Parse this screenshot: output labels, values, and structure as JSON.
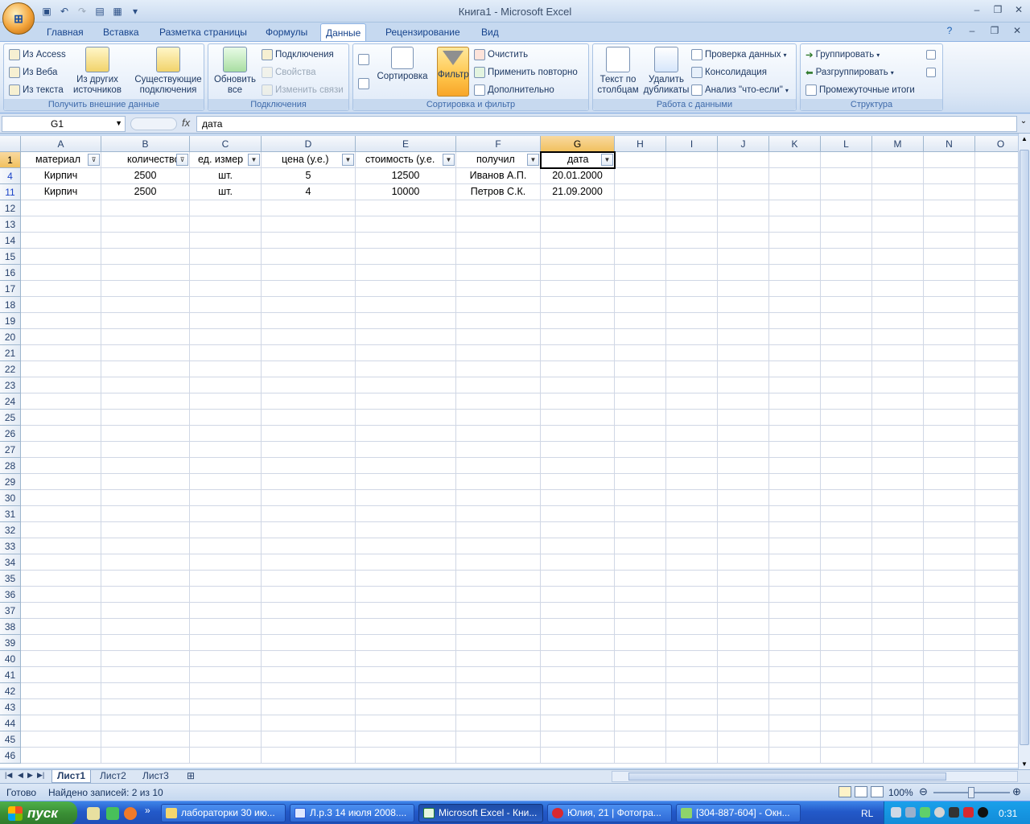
{
  "window": {
    "title": "Книга1 - Microsoft Excel",
    "office_button": "⊞"
  },
  "tabs": [
    "Главная",
    "Вставка",
    "Разметка страницы",
    "Формулы",
    "Данные",
    "Рецензирование",
    "Вид"
  ],
  "active_tab": "Данные",
  "ribbon": {
    "external": {
      "access": "Из Access",
      "web": "Из Веба",
      "text": "Из текста",
      "other_1": "Из других",
      "other_2": "источников",
      "existing_1": "Существующие",
      "existing_2": "подключения",
      "label": "Получить внешние данные"
    },
    "connections": {
      "refresh_1": "Обновить",
      "refresh_2": "все",
      "connections": "Подключения",
      "properties": "Свойства",
      "edit_links": "Изменить связи",
      "label": "Подключения"
    },
    "sort": {
      "sort": "Сортировка",
      "filter": "Фильтр",
      "clear": "Очистить",
      "reapply": "Применить повторно",
      "advanced": "Дополнительно",
      "label": "Сортировка и фильтр"
    },
    "data_tools": {
      "text_cols_1": "Текст по",
      "text_cols_2": "столбцам",
      "remove_dup_1": "Удалить",
      "remove_dup_2": "дубликаты",
      "validation": "Проверка данных",
      "consolidate": "Консолидация",
      "whatif": "Анализ \"что-если\"",
      "label": "Работа с данными"
    },
    "outline": {
      "group": "Группировать",
      "ungroup": "Разгруппировать",
      "subtotal": "Промежуточные итоги",
      "label": "Структура"
    }
  },
  "formula_bar": {
    "name_box": "G1",
    "fx": "fx",
    "value": "дата"
  },
  "columns": [
    "A",
    "B",
    "C",
    "D",
    "E",
    "F",
    "G",
    "H",
    "I",
    "J",
    "K",
    "L",
    "M",
    "N",
    "O"
  ],
  "rows": [
    "1",
    "4",
    "11",
    "12",
    "13",
    "14",
    "15",
    "16",
    "17",
    "18",
    "19",
    "20",
    "21",
    "22",
    "23",
    "24",
    "25",
    "26",
    "27",
    "28",
    "29",
    "30",
    "31",
    "32",
    "33",
    "34",
    "35",
    "36",
    "37",
    "38",
    "39",
    "40",
    "41",
    "42",
    "43",
    "44",
    "45",
    "46"
  ],
  "header_row": [
    "материал",
    "количество",
    "ед. измер",
    "цена (у.е.)",
    "стоимость (у.е.",
    "получил",
    "дата"
  ],
  "data_rows": [
    [
      "Кирпич",
      "2500",
      "шт.",
      "5",
      "12500",
      "Иванов А.П.",
      "20.01.2000"
    ],
    [
      "Кирпич",
      "2500",
      "шт.",
      "4",
      "10000",
      "Петров С.К.",
      "21.09.2000"
    ]
  ],
  "sheets": [
    "Лист1",
    "Лист2",
    "Лист3"
  ],
  "active_sheet": "Лист1",
  "status": {
    "ready": "Готово",
    "records": "Найдено записей: 2 из 10",
    "zoom": "100%"
  },
  "taskbar": {
    "start": "пуск",
    "items": [
      "лабораторки 30 ию...",
      "Л.р.3 14 июля 2008....",
      "Microsoft Excel - Кни...",
      "Юлия, 21 | Фотогра...",
      "[304-887-604] - Окн..."
    ],
    "lang": "RL",
    "clock": "0:31"
  }
}
